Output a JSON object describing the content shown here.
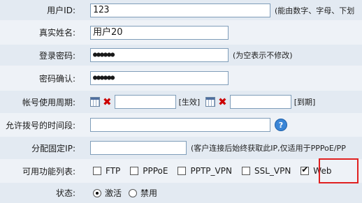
{
  "fields": {
    "user_id": {
      "label": "用户ID:",
      "value": "123",
      "hint": "(能由数字、字母、下划"
    },
    "real_name": {
      "label": "真实姓名:",
      "value": "用户20"
    },
    "login_password": {
      "label": "登录密码:",
      "value": "●●●●●●",
      "hint": "(为空表示不修改)"
    },
    "confirm_password": {
      "label": "密码确认:",
      "value": "●●●●●●"
    },
    "account_period": {
      "label": "帐号使用周期:",
      "start_value": "",
      "start_tag": "[生效]",
      "end_value": "",
      "end_tag": "[到期]"
    },
    "dial_time": {
      "label": "允许拨号的时间段:",
      "value": "",
      "help": "?"
    },
    "fixed_ip": {
      "label": "分配固定IP:",
      "value": "",
      "hint": "(客户连接后始终获取此IP,仅适用于PPPoE/PP"
    },
    "features": {
      "label": "可用功能列表:",
      "options": [
        {
          "label": "FTP",
          "checked": false
        },
        {
          "label": "PPPoE",
          "checked": false
        },
        {
          "label": "PPTP_VPN",
          "checked": false
        },
        {
          "label": "SSL_VPN",
          "checked": false
        },
        {
          "label": "Web",
          "checked": true
        }
      ]
    },
    "status": {
      "label": "状态:",
      "options": [
        {
          "label": "激活",
          "selected": true
        },
        {
          "label": "禁用",
          "selected": false
        }
      ]
    }
  },
  "highlight_color": "#e02020"
}
